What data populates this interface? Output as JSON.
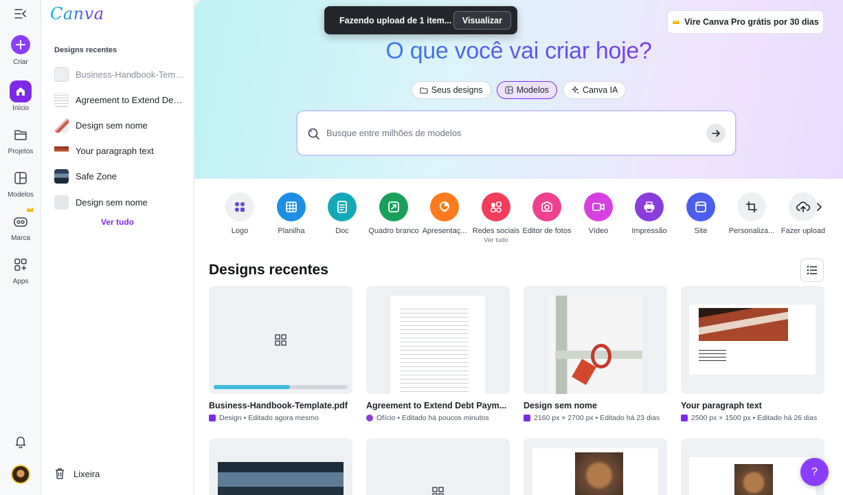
{
  "rail": {
    "create": "Criar",
    "home": "Início",
    "projects": "Projetos",
    "templates": "Modelos",
    "brand": "Marca",
    "apps": "Apps"
  },
  "panel": {
    "logo": "Canva",
    "heading": "Designs recentes",
    "recents": [
      "Business-Handbook-Template.pdf",
      "Agreement to Extend Debt Payment",
      "Design sem nome",
      "Your paragraph text",
      "Safe Zone",
      "Design sem nome"
    ],
    "see_all": "Ver tudo",
    "trash": "Lixeira"
  },
  "toast": {
    "text": "Fazendo upload de 1 item...",
    "button": "Visualizar"
  },
  "pro_button": "Vire Canva Pro grátis por 30 dias",
  "hero": {
    "title": "O que você vai criar hoje?",
    "pills": [
      "Seus designs",
      "Modelos",
      "Canva IA"
    ]
  },
  "search": {
    "placeholder": "Busque entre milhões de modelos"
  },
  "categories": [
    {
      "label": "Logo",
      "color": "#eef0f3"
    },
    {
      "label": "Planilha",
      "color": "#1a8fe3"
    },
    {
      "label": "Doc",
      "color": "#14a9b8"
    },
    {
      "label": "Quadro branco",
      "color": "#18a05a"
    },
    {
      "label": "Apresentaç...",
      "color": "#ff7a1a"
    },
    {
      "label": "Redes sociais",
      "sub": "Ver tudo",
      "color": "#f23d5c"
    },
    {
      "label": "Editor de fotos",
      "color": "#f0418f"
    },
    {
      "label": "Vídeo",
      "color": "#d73fe0"
    },
    {
      "label": "Impressão",
      "color": "#8a3ddb"
    },
    {
      "label": "Site",
      "color": "#4b5ef0"
    },
    {
      "label": "Personaliza...",
      "color": "#eef0f3"
    },
    {
      "label": "Fazer upload",
      "color": "#eef0f3"
    }
  ],
  "section_title": "Designs recentes",
  "designs": [
    {
      "name": "Business-Handbook-Template.pdf",
      "meta": "Design • Editado agora mesmo",
      "upload_progress": 0.57
    },
    {
      "name": "Agreement to Extend Debt Paym...",
      "meta": "Ofício • Editado há poucos minutos"
    },
    {
      "name": "Design sem nome",
      "meta": "2160 px × 2700 px • Editado há 23 dias"
    },
    {
      "name": "Your paragraph text",
      "meta": "2500 px × 1500 px • Editado há 26 dias"
    }
  ],
  "help": "?"
}
